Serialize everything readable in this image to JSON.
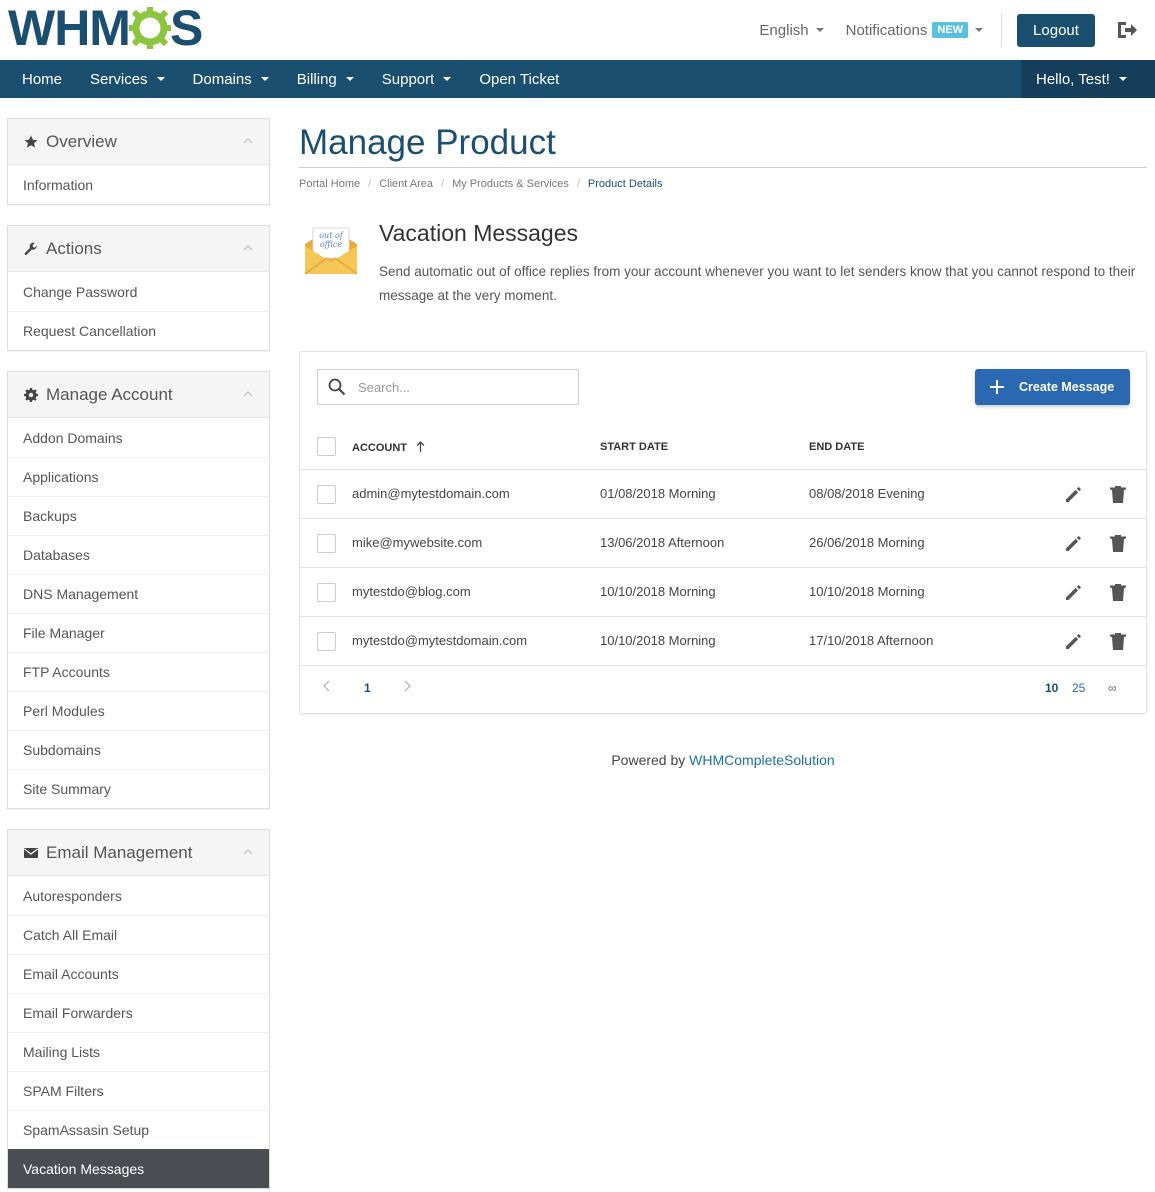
{
  "header": {
    "logo_left": "WHM",
    "logo_right": "S",
    "language": "English",
    "notifications": "Notifications",
    "notifications_badge": "NEW",
    "logout": "Logout"
  },
  "nav": {
    "items": [
      {
        "label": "Home",
        "caret": false
      },
      {
        "label": "Services",
        "caret": true
      },
      {
        "label": "Domains",
        "caret": true
      },
      {
        "label": "Billing",
        "caret": true
      },
      {
        "label": "Support",
        "caret": true
      },
      {
        "label": "Open Ticket",
        "caret": false
      }
    ],
    "user": "Hello, Test!"
  },
  "sidebar": {
    "overview": {
      "title": "Overview",
      "items": [
        "Information"
      ]
    },
    "actions": {
      "title": "Actions",
      "items": [
        "Change Password",
        "Request Cancellation"
      ]
    },
    "manage": {
      "title": "Manage Account",
      "items": [
        "Addon Domains",
        "Applications",
        "Backups",
        "Databases",
        "DNS Management",
        "File Manager",
        "FTP Accounts",
        "Perl Modules",
        "Subdomains",
        "Site Summary"
      ]
    },
    "email": {
      "title": "Email Management",
      "items": [
        "Autoresponders",
        "Catch All Email",
        "Email Accounts",
        "Email Forwarders",
        "Mailing Lists",
        "SPAM Filters",
        "SpamAssasin Setup",
        "Vacation Messages"
      ],
      "active": "Vacation Messages"
    }
  },
  "page": {
    "title": "Manage Product",
    "breadcrumb": [
      "Portal Home",
      "Client Area",
      "My Products & Services",
      "Product Details"
    ],
    "section_title": "Vacation Messages",
    "section_desc": "Send automatic out of office replies from your account whenever you want to let senders know that you cannot respond to their message at the very moment.",
    "icon_text_1": "out of",
    "icon_text_2": "office"
  },
  "table": {
    "search_placeholder": "Search...",
    "create_button": "Create Message",
    "columns": {
      "account": "ACCOUNT",
      "start": "START DATE",
      "end": "END DATE"
    },
    "rows": [
      {
        "account": "admin@mytestdomain.com",
        "start": "01/08/2018 Morning",
        "end": "08/08/2018 Evening"
      },
      {
        "account": "mike@mywebsite.com",
        "start": "13/06/2018 Afternoon",
        "end": "26/06/2018 Morning"
      },
      {
        "account": "mytestdo@blog.com",
        "start": "10/10/2018 Morning",
        "end": "10/10/2018 Morning"
      },
      {
        "account": "mytestdo@mytestdomain.com",
        "start": "10/10/2018 Morning",
        "end": "17/10/2018 Afternoon"
      }
    ],
    "pagination": {
      "current": "1",
      "sizes": [
        "10",
        "25",
        "∞"
      ]
    }
  },
  "footer": {
    "prefix": "Powered by ",
    "link": "WHMCompleteSolution"
  },
  "colors": {
    "brand": "#1b4f6f",
    "accent": "#2a68b1",
    "badge": "#5bc0de",
    "active_item": "#4a4e53",
    "logo_gear": "#8cc63f"
  }
}
